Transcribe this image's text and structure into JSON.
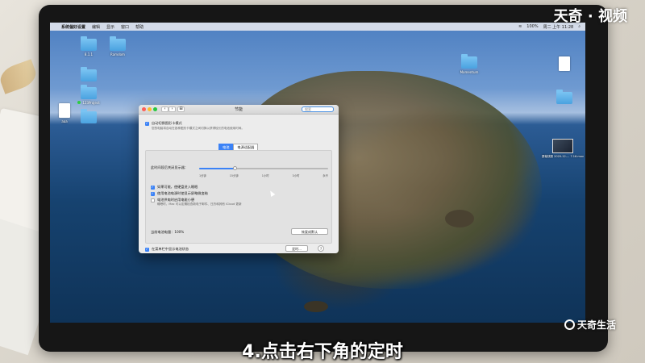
{
  "watermark_top": "天奇 · 视频",
  "watermark_bottom": "天奇生活",
  "caption": "4.点击右下角的定时",
  "menubar": {
    "app_name": "系统偏好设置",
    "menus": [
      "编辑",
      "显示",
      "窗口",
      "帮助"
    ],
    "right_items": [
      "100%",
      "周二 上午 11:28"
    ]
  },
  "desktop_icons": [
    {
      "label": "8.1.1",
      "kind": "folder"
    },
    {
      "label": "Ramdom",
      "kind": "folder"
    },
    {
      "label": "",
      "kind": "folder"
    },
    {
      "label": "123Project",
      "kind": "folder"
    },
    {
      "label": "aaa",
      "kind": "doc"
    },
    {
      "label": "",
      "kind": "folder"
    },
    {
      "label": "Momentum",
      "kind": "folder"
    },
    {
      "label": "",
      "kind": "doc"
    },
    {
      "label": "",
      "kind": "folder"
    },
    {
      "label": "屏幕快照 2020-12-... 7.16.mov",
      "kind": "thumb"
    }
  ],
  "window": {
    "title": "节能",
    "search_placeholder": "搜索",
    "auto_switch_label": "自动切换图形卡模式",
    "auto_switch_desc": "您的电脑将自动在各种图形卡模式之间切换以获得较长的电池使用时间。",
    "tabs": [
      "电池",
      "电源适配器"
    ],
    "slider_label": "此时间段后关闭显示器：",
    "slider_ticks": [
      "1分钟",
      "15分钟",
      "1小时",
      "3小时",
      "永不"
    ],
    "slider_value": 0.28,
    "options": [
      {
        "label": "如果可能，使硬盘进入睡眠",
        "checked": true
      },
      {
        "label": "使用电池电源时使显示屏略微变暗",
        "checked": true
      },
      {
        "label": "电池供电时启用电能小憩",
        "checked": false
      }
    ],
    "power_nap_desc": "睡眠时，Mac 可以定期检查新电子邮件、日历和其他 iCloud 更新",
    "battery_label": "当前电池电量：100%",
    "restore_button": "恢复成默认",
    "menubar_checkbox": "在菜单栏中显示电池状态",
    "schedule_button": "定时...",
    "help_button": "?"
  }
}
